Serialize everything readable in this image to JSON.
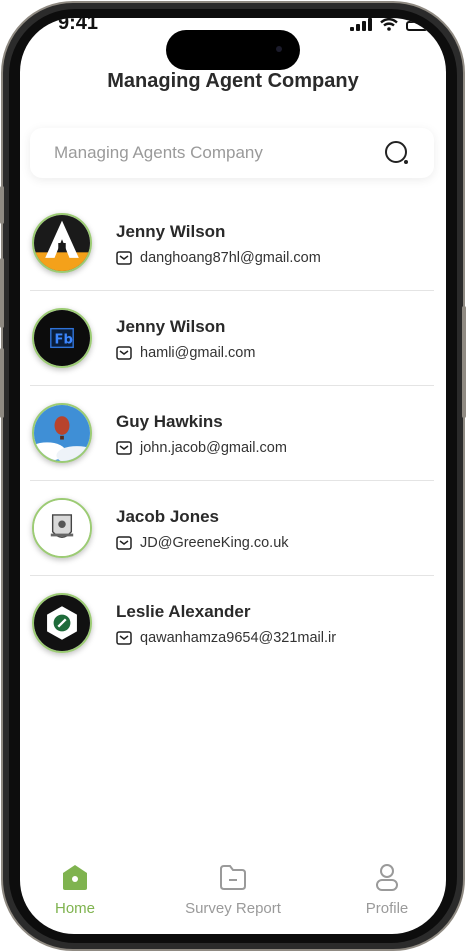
{
  "status_bar": {
    "time": "9:41"
  },
  "header": {
    "title": "Managing Agent Company"
  },
  "search": {
    "placeholder": "Managing Agents Company"
  },
  "agents": [
    {
      "name": "Jenny Wilson",
      "email": "danghoang87hl@gmail.com",
      "avatar": "letter-a-logo"
    },
    {
      "name": "Jenny Wilson",
      "email": "hamli@gmail.com",
      "avatar": "fb-logo"
    },
    {
      "name": "Guy Hawkins",
      "email": "john.jacob@gmail.com",
      "avatar": "hot-air-balloon"
    },
    {
      "name": "Jacob Jones",
      "email": "JD@GreeneKing.co.uk",
      "avatar": "crest-logo"
    },
    {
      "name": "Leslie Alexander",
      "email": "qawanhamza9654@321mail.ir",
      "avatar": "hexagon-logo"
    }
  ],
  "tabs": [
    {
      "label": "Home",
      "icon": "home-icon",
      "active": true
    },
    {
      "label": "Survey Report",
      "icon": "folder-icon",
      "active": false
    },
    {
      "label": "Profile",
      "icon": "profile-icon",
      "active": false
    }
  ],
  "colors": {
    "accent": "#7fb34f",
    "inactive": "#9a9a9a",
    "text": "#2a2a2a"
  }
}
